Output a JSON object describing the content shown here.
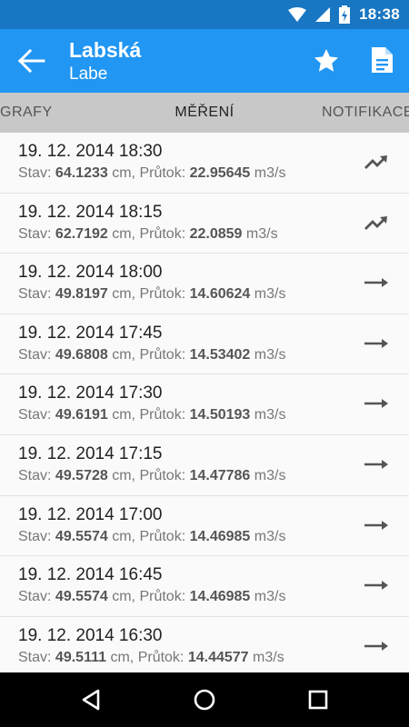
{
  "status": {
    "time": "18:38",
    "icons": [
      "wifi-icon",
      "signal-icon",
      "battery-charging-icon"
    ]
  },
  "app_bar": {
    "title": "Labská",
    "subtitle": "Labe",
    "icons": [
      "back-arrow-icon",
      "star-icon",
      "document-icon"
    ]
  },
  "tabs": [
    {
      "label": "GRAFY"
    },
    {
      "label": "MĚŘENÍ",
      "active": true
    },
    {
      "label": "NOTIFIKACE"
    }
  ],
  "measure_labels": {
    "stav": "Stav:",
    "stav_unit": "cm,",
    "prutok": "Průtok:",
    "prutok_unit": "m3/s"
  },
  "rows": [
    {
      "date": "19. 12. 2014 18:30",
      "stav": "64.1233",
      "prutok": "22.95645",
      "trend": "trending-up-icon"
    },
    {
      "date": "19. 12. 2014 18:15",
      "stav": "62.7192",
      "prutok": "22.0859",
      "trend": "trending-up-icon"
    },
    {
      "date": "19. 12. 2014 18:00",
      "stav": "49.8197",
      "prutok": "14.60624",
      "trend": "arrow-right-icon"
    },
    {
      "date": "19. 12. 2014 17:45",
      "stav": "49.6808",
      "prutok": "14.53402",
      "trend": "arrow-right-icon"
    },
    {
      "date": "19. 12. 2014 17:30",
      "stav": "49.6191",
      "prutok": "14.50193",
      "trend": "arrow-right-icon"
    },
    {
      "date": "19. 12. 2014 17:15",
      "stav": "49.5728",
      "prutok": "14.47786",
      "trend": "arrow-right-icon"
    },
    {
      "date": "19. 12. 2014 17:00",
      "stav": "49.5574",
      "prutok": "14.46985",
      "trend": "arrow-right-icon"
    },
    {
      "date": "19. 12. 2014 16:45",
      "stav": "49.5574",
      "prutok": "14.46985",
      "trend": "arrow-right-icon"
    },
    {
      "date": "19. 12. 2014 16:30",
      "stav": "49.5111",
      "prutok": "14.44577",
      "trend": "arrow-right-icon"
    }
  ],
  "nav": {
    "icons": [
      "back-triangle-icon",
      "home-circle-icon",
      "recents-square-icon"
    ]
  },
  "colors": {
    "status_bar": "#1976c2",
    "app_bar": "#2196f3",
    "tabs": "#c8c8c8",
    "text": "#222222",
    "muted": "#777777"
  }
}
